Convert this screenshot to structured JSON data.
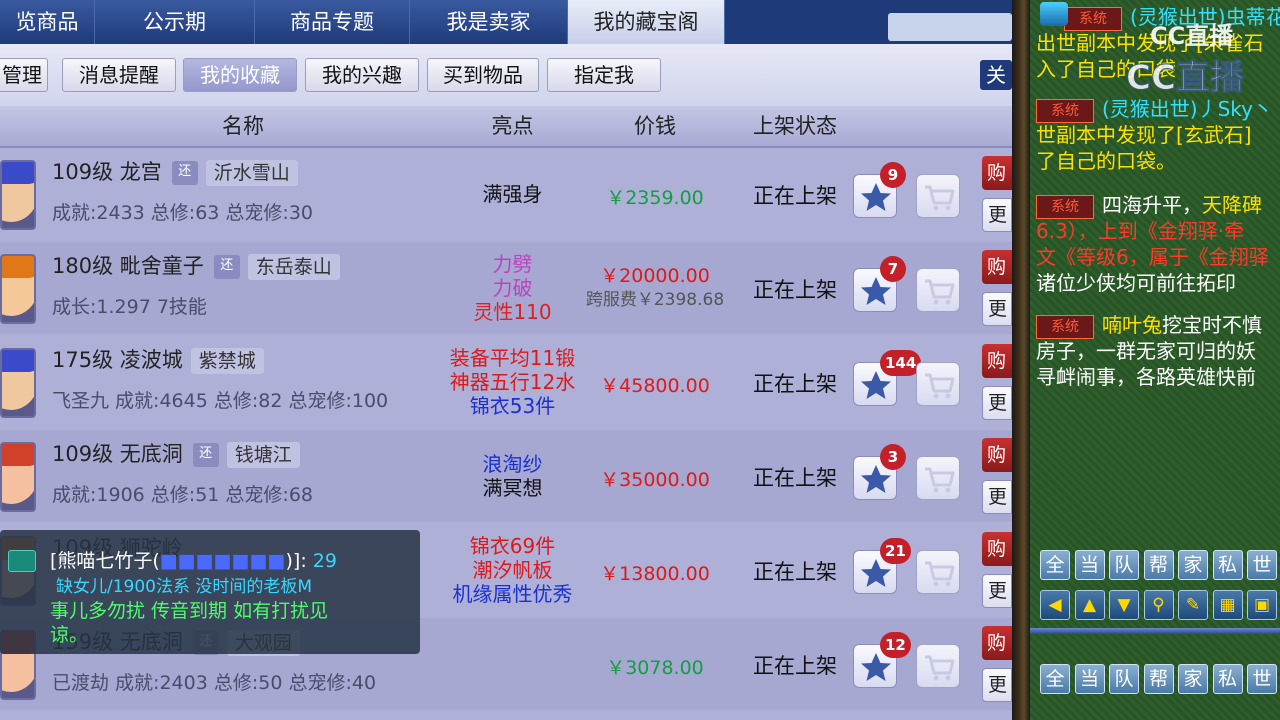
{
  "tabs": [
    "览商品",
    "公示期",
    "商品专题",
    "我是卖家",
    "我的藏宝阁"
  ],
  "active_tab": 4,
  "subtabs": [
    "管理",
    "消息提醒",
    "我的收藏",
    "我的兴趣",
    "买到物品",
    "指定我"
  ],
  "active_subtab": 2,
  "sub_right": "关",
  "table_headers": {
    "name": "名称",
    "highlight": "亮点",
    "price": "价钱",
    "status": "上架状态"
  },
  "rows": [
    {
      "line1": "109级 龙宫",
      "huan": "还",
      "server": "沂水雪山",
      "line2": "成就:2433 总修:63 总宠修:30",
      "highlights": [
        {
          "text": "满强身",
          "color": "#111111"
        }
      ],
      "price": "￥2359.00",
      "price_color": "#10a040",
      "price2": "",
      "status": "正在上架",
      "fav_count": "9",
      "buy": "购",
      "more": "更",
      "avatar": "blue"
    },
    {
      "line1": "180级 毗舍童子",
      "huan": "还",
      "server": "东岳泰山",
      "line2": "成长:1.297 7技能",
      "highlights": [
        {
          "text": "力劈",
          "color": "#c040c0"
        },
        {
          "text": "力破",
          "color": "#c040c0"
        },
        {
          "text": "灵性110",
          "color": "#e02020"
        }
      ],
      "price": "￥20000.00",
      "price_color": "#e01818",
      "price2": "跨服费￥2398.68",
      "status": "正在上架",
      "fav_count": "7",
      "buy": "购",
      "more": "更",
      "avatar": "orange"
    },
    {
      "line1": "175级 凌波城",
      "huan": "",
      "server": "紫禁城",
      "line2": "飞圣九 成就:4645 总修:82 总宠修:100",
      "highlights": [
        {
          "text": "装备平均11锻",
          "color": "#e01818"
        },
        {
          "text": "神器五行12水",
          "color": "#e01818"
        },
        {
          "text": "锦衣53件",
          "color": "#1a30d0"
        }
      ],
      "price": "￥45800.00",
      "price_color": "#e01818",
      "price2": "",
      "status": "正在上架",
      "fav_count": "144",
      "buy": "购",
      "more": "更",
      "avatar": "blue"
    },
    {
      "line1": "109级 无底洞",
      "huan": "还",
      "server": "钱塘江",
      "line2": "成就:1906 总修:51 总宠修:68",
      "highlights": [
        {
          "text": "浪淘纱",
          "color": "#1a30d0"
        },
        {
          "text": "满冥想",
          "color": "#111111"
        }
      ],
      "price": "￥35000.00",
      "price_color": "#e01818",
      "price2": "",
      "status": "正在上架",
      "fav_count": "3",
      "buy": "购",
      "more": "更",
      "avatar": "red"
    },
    {
      "line1": "109级 狮驼岭",
      "huan": "",
      "server": "",
      "line2": "",
      "highlights": [
        {
          "text": "锦衣69件",
          "color": "#e01818"
        },
        {
          "text": "潮汐帆板",
          "color": "#e01818"
        },
        {
          "text": "机缘属性优秀",
          "color": "#1a30d0"
        }
      ],
      "price": "￥13800.00",
      "price_color": "#e01818",
      "price2": "",
      "status": "正在上架",
      "fav_count": "21",
      "buy": "购",
      "more": "更",
      "avatar": "orange"
    },
    {
      "line1": "159级 无底洞",
      "huan": "还",
      "server": "大观园",
      "line2": "已渡劫 成就:2403 总修:50 总宠修:40",
      "highlights": [],
      "price": "￥3078.00",
      "price_color": "#10a040",
      "price2": "",
      "status": "正在上架",
      "fav_count": "12",
      "buy": "购",
      "more": "更",
      "avatar": "red"
    }
  ],
  "chat_overlay": {
    "name": "[熊喵七竹子(",
    "name_tail": ")]:",
    "level": "29",
    "line2": "缺女儿/1900法系 没时间的老板M",
    "line3": "事儿多勿扰   传音到期 如有打扰见",
    "line4": "谅。"
  },
  "right_chat": {
    "line1": "(灵猴出世)虫蒂花",
    "line2": "出世副本中发现了[朱雀石",
    "line3": "入了自己的口袋",
    "line4": "(灵猴出世)丿Sky丶",
    "line5": "世副本中发现了[玄武石]",
    "line6": "了自己的口袋。",
    "line7_prefix": "四海升平，",
    "line7_hl": "天降碑",
    "line8": "6.3），上到《金翔驿·牵",
    "line9": "文《等级6，属于《金翔驿",
    "line10": "诸位少侠均可前往拓印",
    "line11_name": "喃叶兔",
    "line11": "挖宝时不慎",
    "line12": "房子，一群无家可归的妖",
    "line13": "寻衅闹事，各路英雄快前",
    "sys_label": "系统"
  },
  "channel_tabs": [
    "全",
    "当",
    "队",
    "帮",
    "家",
    "私",
    "世"
  ],
  "channel_tabs2": [
    "全",
    "当",
    "队",
    "帮",
    "家",
    "私",
    "世"
  ],
  "icon_buttons": [
    "arrow-left-icon",
    "arrow-up-icon",
    "arrow-down-icon",
    "search-icon",
    "note-icon",
    "grid-icon",
    "lock-icon"
  ],
  "watermark": {
    "small": "CC直播",
    "large": "CC直播"
  }
}
